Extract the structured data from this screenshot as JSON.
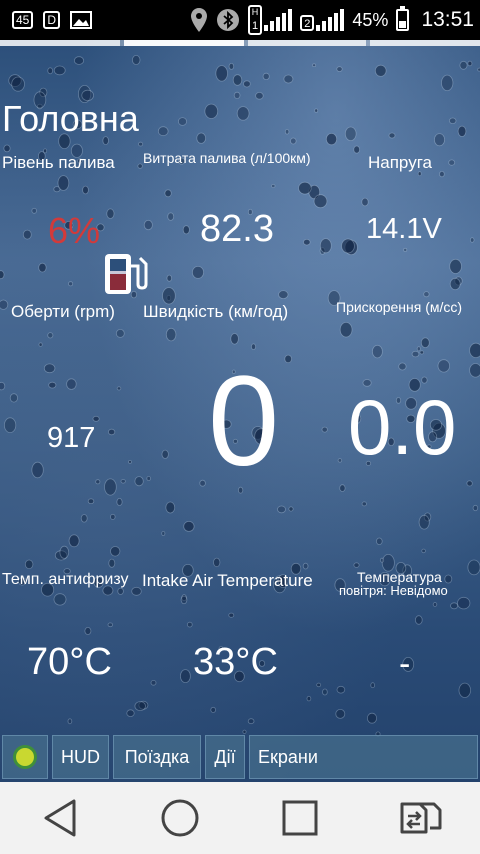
{
  "status_bar": {
    "notif_1": "45",
    "notif_2": "D",
    "battery_percent": "45%",
    "battery_level": 0.45,
    "time": "13:51",
    "sim1_label": "1",
    "sim1_type": "H",
    "sim2_label": "2",
    "icons": [
      "notification-45-icon",
      "notification-d-icon",
      "gallery-icon",
      "location-icon",
      "bluetooth-icon",
      "signal-sim1-icon",
      "signal-sim2-icon",
      "battery-icon"
    ]
  },
  "screen": {
    "title": "Головна"
  },
  "gauges": {
    "fuel_level": {
      "label": "Рівень палива",
      "value": "6%",
      "color": "#d23a3a"
    },
    "fuel_consumption": {
      "label": "Витрата палива (л/100км)",
      "value": "82.3"
    },
    "voltage": {
      "label": "Напруга",
      "value": "14.1V"
    },
    "rpm": {
      "label": "Оберти (rpm)",
      "value": "917"
    },
    "speed": {
      "label": "Швидкість (км/год)",
      "value": "0"
    },
    "acceleration": {
      "label": "Прискорення (м/сс)",
      "value": "0.0"
    },
    "coolant_temp": {
      "label": "Темп. антифризу",
      "value": "70°C"
    },
    "intake_air_temp": {
      "label": "Intake Air Temperature",
      "value": "33°C"
    },
    "air_temp": {
      "label_line1": "Температура",
      "label_line2": "повітря: Невідомо",
      "value": "-"
    }
  },
  "tabs": {
    "hud": "HUD",
    "trip": "Поїздка",
    "actions": "Дії",
    "screens": "Екрани"
  },
  "nav_icons": [
    "back-icon",
    "home-icon",
    "recents-icon",
    "switch-sim-icon"
  ]
}
